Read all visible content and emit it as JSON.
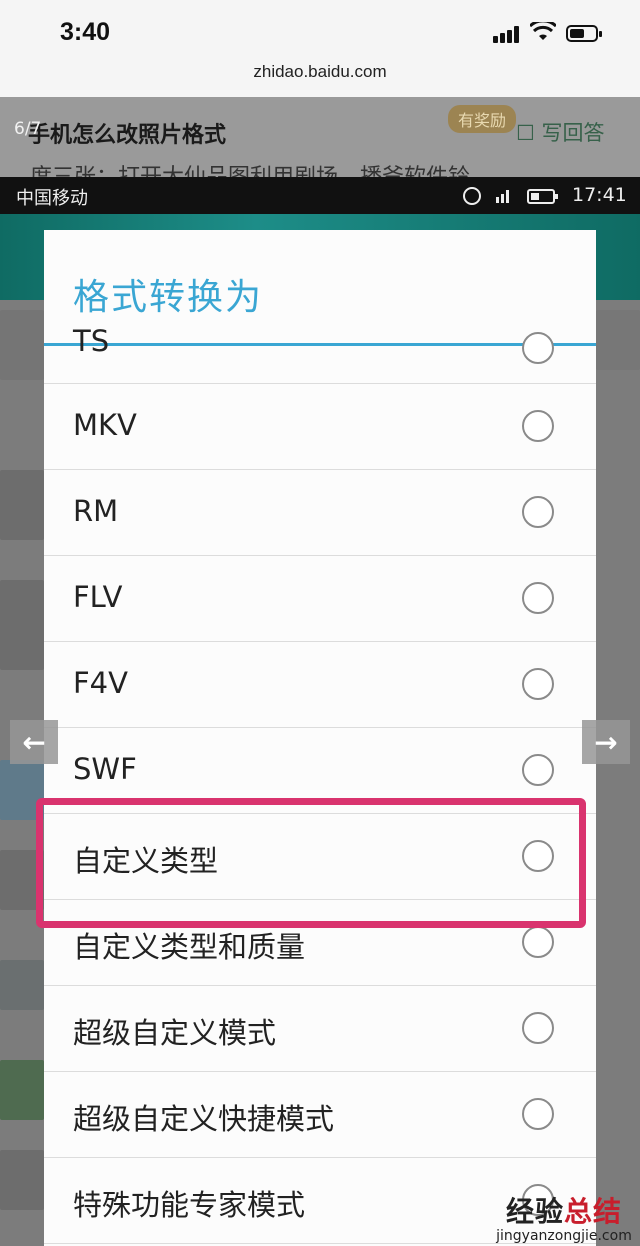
{
  "ios_status": {
    "time": "3:40"
  },
  "browser": {
    "url": "zhidao.baidu.com"
  },
  "zhidao": {
    "image_counter": "6/7",
    "question_title": "手机怎么改照片格式",
    "reward_badge": "有奖励",
    "answer_button": "写回答",
    "answer_snippet": "度三张：打开大仙品图利用剧场，播爷软件铃"
  },
  "android_status": {
    "carrier": "中国移动",
    "time": "17:41"
  },
  "dialog": {
    "title": "格式转换为",
    "partial_option": "TS",
    "options": [
      {
        "label": "MKV"
      },
      {
        "label": "RM"
      },
      {
        "label": "FLV"
      },
      {
        "label": "F4V"
      },
      {
        "label": "SWF"
      },
      {
        "label": "自定义类型",
        "highlighted": true
      },
      {
        "label": "自定义类型和质量"
      },
      {
        "label": "超级自定义模式"
      },
      {
        "label": "超级自定义快捷模式"
      },
      {
        "label": "特殊功能专家模式"
      }
    ]
  },
  "gallery_nav": {
    "prev_icon": "arrow-left-icon",
    "next_icon": "arrow-right-icon"
  },
  "watermark": {
    "title_part1": "经验",
    "title_part2": "总结",
    "url": "jingyanzongjie.com"
  },
  "colors": {
    "accent": "#3aa6d3",
    "highlight": "#d9336e"
  }
}
